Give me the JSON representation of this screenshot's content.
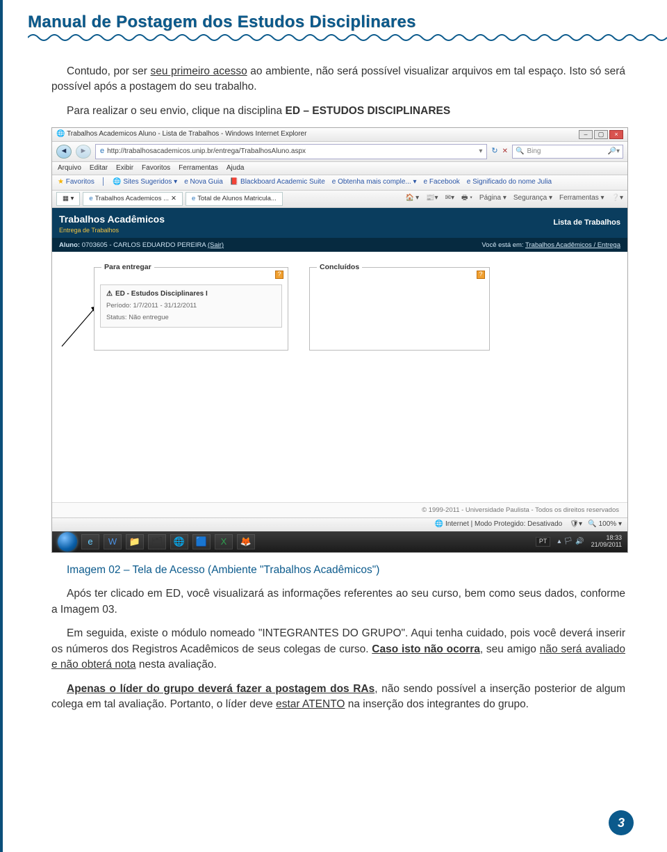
{
  "doc_title": "Manual de Postagem dos Estudos Disciplinares",
  "para1_a": "Contudo, por ser ",
  "para1_b": "seu primeiro acesso",
  "para1_c": " ao ambiente, não será possível visualizar arquivos em tal espaço. Isto só será possível após a postagem do seu trabalho.",
  "para2_a": "Para realizar o seu envio, clique na disciplina ",
  "para2_b": "ED – ESTUDOS DISCIPLINARES",
  "caption": "Imagem 02 – Tela de Acesso (Ambiente \"Trabalhos Acadêmicos\")",
  "para3": "Após ter clicado em ED, você visualizará as informações referentes ao seu curso, bem como seus dados, conforme a Imagem 03.",
  "para4_a": "Em seguida, existe o módulo nomeado \"INTEGRANTES DO GRUPO\". Aqui tenha cuidado, pois você deverá inserir os números dos Registros Acadêmicos de seus colegas de curso. ",
  "para4_b": "Caso isto não ocorra",
  "para4_c": ", seu amigo ",
  "para4_d": "não será avaliado e não obterá nota",
  "para4_e": " nesta avaliação.",
  "para5_a": "Apenas o líder do grupo deverá fazer a postagem dos RAs",
  "para5_b": ", não sendo possível a inserção posterior de algum colega em tal avaliação. Portanto, o líder deve ",
  "para5_c": "estar ATENTO",
  "para5_d": " na inserção dos integrantes do grupo.",
  "page_number": "3",
  "screenshot": {
    "window_title": "Trabalhos Academicos Aluno - Lista de Trabalhos - Windows Internet Explorer",
    "url": "http://trabalhosacademicos.unip.br/entrega/TrabalhosAluno.aspx",
    "search_placeholder": "Bing",
    "menu": [
      "Arquivo",
      "Editar",
      "Exibir",
      "Favoritos",
      "Ferramentas",
      "Ajuda"
    ],
    "fav_label": "Favoritos",
    "fav_items": [
      "Sites Sugeridos ▾",
      "Nova Guia",
      "Blackboard Academic Suite",
      "Obtenha mais comple... ▾",
      "Facebook",
      "Significado do nome Julia"
    ],
    "tabs": [
      "Trabalhos Academicos ...",
      "Total de Alunos Matricula..."
    ],
    "tools": {
      "pagina": "Página ▾",
      "seguranca": "Segurança ▾",
      "ferramentas": "Ferramentas ▾"
    },
    "app_title": "Trabalhos Acadêmicos",
    "app_sub": "Entrega de Trabalhos",
    "page_heading": "Lista de Trabalhos",
    "aluno_label": "Aluno:",
    "aluno_value": "0703605 - CARLOS EDUARDO PEREIRA",
    "sair": "(Sair)",
    "breadcrumb_label": "Você está em:",
    "breadcrumb": "Trabalhos Acadêmicos / Entrega",
    "fs_left": "Para entregar",
    "fs_right": "Concluídos",
    "ed_title": "ED - Estudos Disciplinares I",
    "ed_period": "Período: 1/7/2011 - 31/12/2011",
    "ed_status": "Status: Não entregue",
    "copyright": "© 1999-2011 - Universidade Paulista - Todos os direitos reservados",
    "status_zone": "Internet | Modo Protegido: Desativado",
    "zoom": "100%",
    "lang": "PT",
    "clock_time": "18:33",
    "clock_date": "21/09/2011"
  }
}
